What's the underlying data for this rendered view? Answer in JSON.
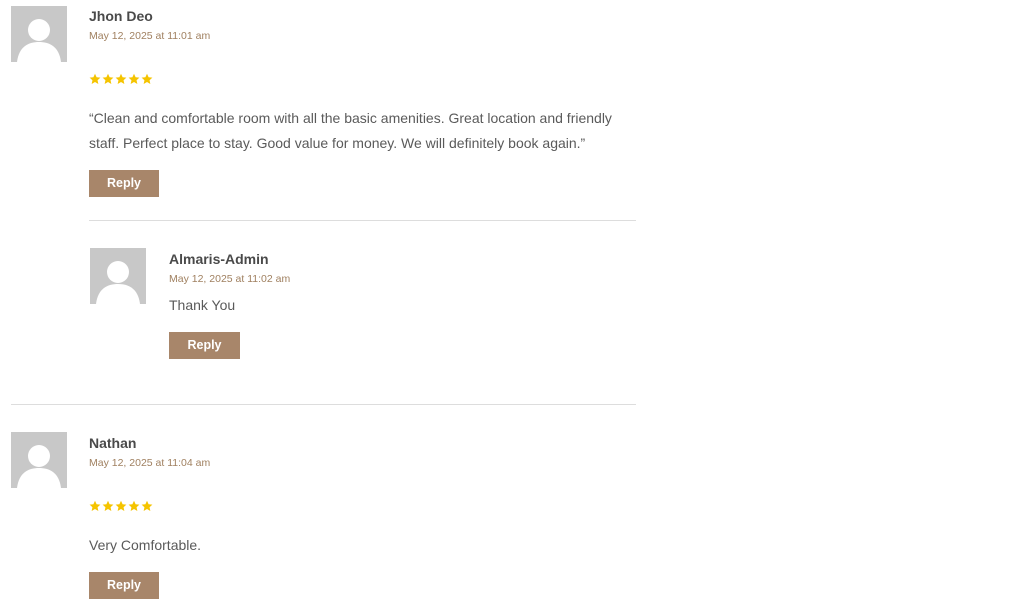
{
  "comments": [
    {
      "author": "Jhon Deo",
      "date": "May 12, 2025 at 11:01 am",
      "rating": 5,
      "text": "“Clean and comfortable room with all the basic amenities. Great location and friendly staff. Perfect place to stay. Good value for money. We will definitely book again.”",
      "reply_label": "Reply",
      "replies": [
        {
          "author": "Almaris-Admin",
          "date": "May 12, 2025 at 11:02 am",
          "text": "Thank You",
          "reply_label": "Reply"
        }
      ]
    },
    {
      "author": "Nathan",
      "date": "May 12, 2025 at 11:04 am",
      "rating": 5,
      "text": "Very Comfortable.",
      "reply_label": "Reply"
    }
  ],
  "colors": {
    "star": "#f5c400",
    "reply_button": "#a8866a",
    "date": "#a08060",
    "avatar_bg": "#c8c8c8",
    "divider": "#dddddd"
  },
  "icons": {
    "avatar": "default-user-avatar-icon",
    "rating": "star-icon"
  }
}
